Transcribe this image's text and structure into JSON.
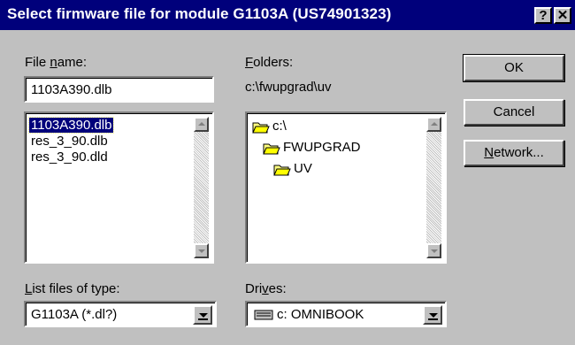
{
  "window": {
    "title": "Select firmware file for module G1103A (US74901323)",
    "help_label": "?",
    "close_label": "✕"
  },
  "file_name": {
    "label": "File name:",
    "value": "1103A390.dlb",
    "files": [
      "1103A390.dlb",
      "res_3_90.dlb",
      "res_3_90.dld"
    ],
    "selected_index": 0
  },
  "folders": {
    "label": "Folders:",
    "current_path": "c:\\fwupgrad\\uv",
    "tree": [
      {
        "name": "c:\\",
        "icon": "open-folder-icon"
      },
      {
        "name": "FWUPGRAD",
        "icon": "open-folder-icon"
      },
      {
        "name": "UV",
        "icon": "open-folder-icon"
      }
    ]
  },
  "buttons": {
    "ok": "OK",
    "cancel": "Cancel",
    "network": "Network..."
  },
  "file_type": {
    "label": "List files of type:",
    "value": "G1103A (*.dl?)"
  },
  "drives": {
    "label": "Drives:",
    "value": "c: OMNIBOOK",
    "icon": "hard-drive-icon"
  }
}
